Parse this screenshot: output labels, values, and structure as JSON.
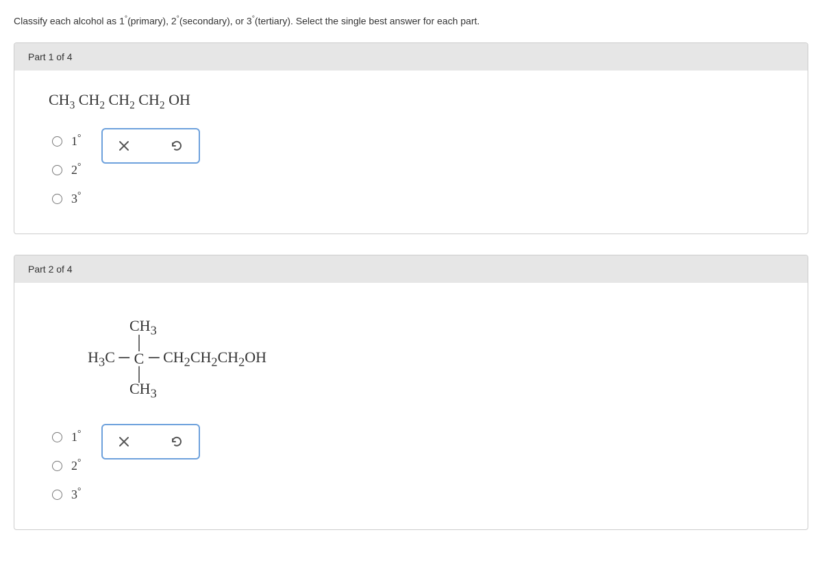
{
  "question": {
    "prefix": "Classify each alcohol as ",
    "t1": "1",
    "t1_label": "(primary), ",
    "t2": "2",
    "t2_label": "(secondary), or ",
    "t3": "3",
    "t3_label": "(tertiary). Select the single best answer for each part."
  },
  "parts": [
    {
      "header": "Part 1 of 4",
      "formula_type": "linear",
      "formula": {
        "seg": [
          "CH",
          "3",
          " CH",
          "2",
          " CH",
          "2",
          " CH",
          "2",
          " OH"
        ]
      },
      "options": [
        {
          "value": "1"
        },
        {
          "value": "2"
        },
        {
          "value": "3"
        }
      ]
    },
    {
      "header": "Part 2 of 4",
      "formula_type": "structural",
      "structural": {
        "top": [
          "CH",
          "3"
        ],
        "left": [
          "H",
          "3",
          "C"
        ],
        "center": "C",
        "right": [
          "CH",
          "2",
          "CH",
          "2",
          "CH",
          "2",
          "OH"
        ],
        "bottom": [
          "CH",
          "3"
        ]
      },
      "options": [
        {
          "value": "1"
        },
        {
          "value": "2"
        },
        {
          "value": "3"
        }
      ]
    }
  ],
  "toolbar": {
    "clear_title": "Clear",
    "reset_title": "Reset"
  }
}
